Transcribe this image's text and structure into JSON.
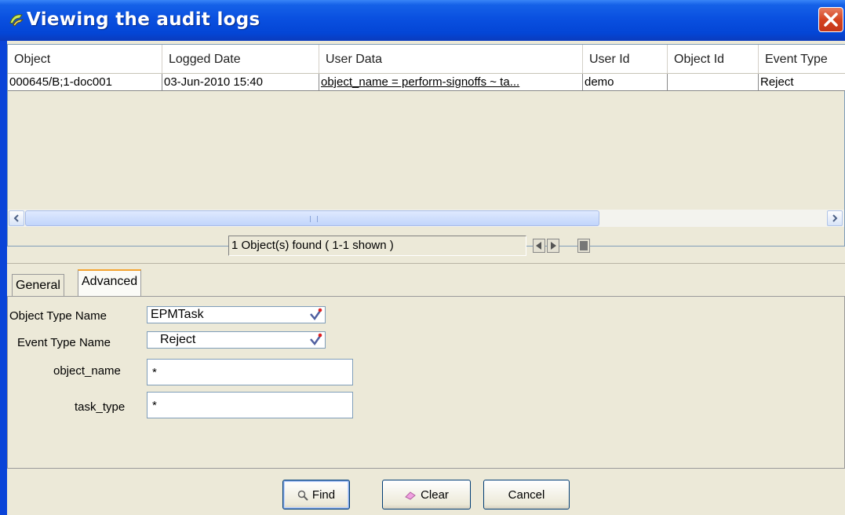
{
  "window": {
    "title": "Viewing the audit logs"
  },
  "table": {
    "columns": [
      "Object",
      "Logged Date",
      "User Data",
      "User Id",
      "Object Id",
      "Event Type"
    ],
    "rows": [
      {
        "object": "000645/B;1-doc001",
        "logged_date": "03-Jun-2010 15:40",
        "user_data": "object_name = perform-signoffs ~ ta...",
        "user_id": "demo",
        "object_id": "",
        "event_type": "Reject"
      }
    ]
  },
  "status": {
    "found_text": "1 Object(s) found ( 1-1  shown )"
  },
  "tabs": [
    {
      "label": "General",
      "active": false
    },
    {
      "label": "Advanced",
      "active": true
    }
  ],
  "form": {
    "object_type_label": "Object Type Name",
    "object_type_value": "EPMTask",
    "event_type_label": "Event Type Name",
    "event_type_value": "Reject",
    "object_name_label": "object_name",
    "object_name_value": "*",
    "task_type_label": "task_type",
    "task_type_value": "*"
  },
  "buttons": {
    "find": "Find",
    "clear": "Clear",
    "cancel": "Cancel"
  },
  "colors": {
    "titlebar": "#0a50e0",
    "close": "#d54320",
    "active_tab_accent": "#f4a430"
  },
  "icons": [
    "arrow-app-icon",
    "close-icon",
    "chevron-down-icon",
    "search-icon",
    "eraser-icon"
  ]
}
